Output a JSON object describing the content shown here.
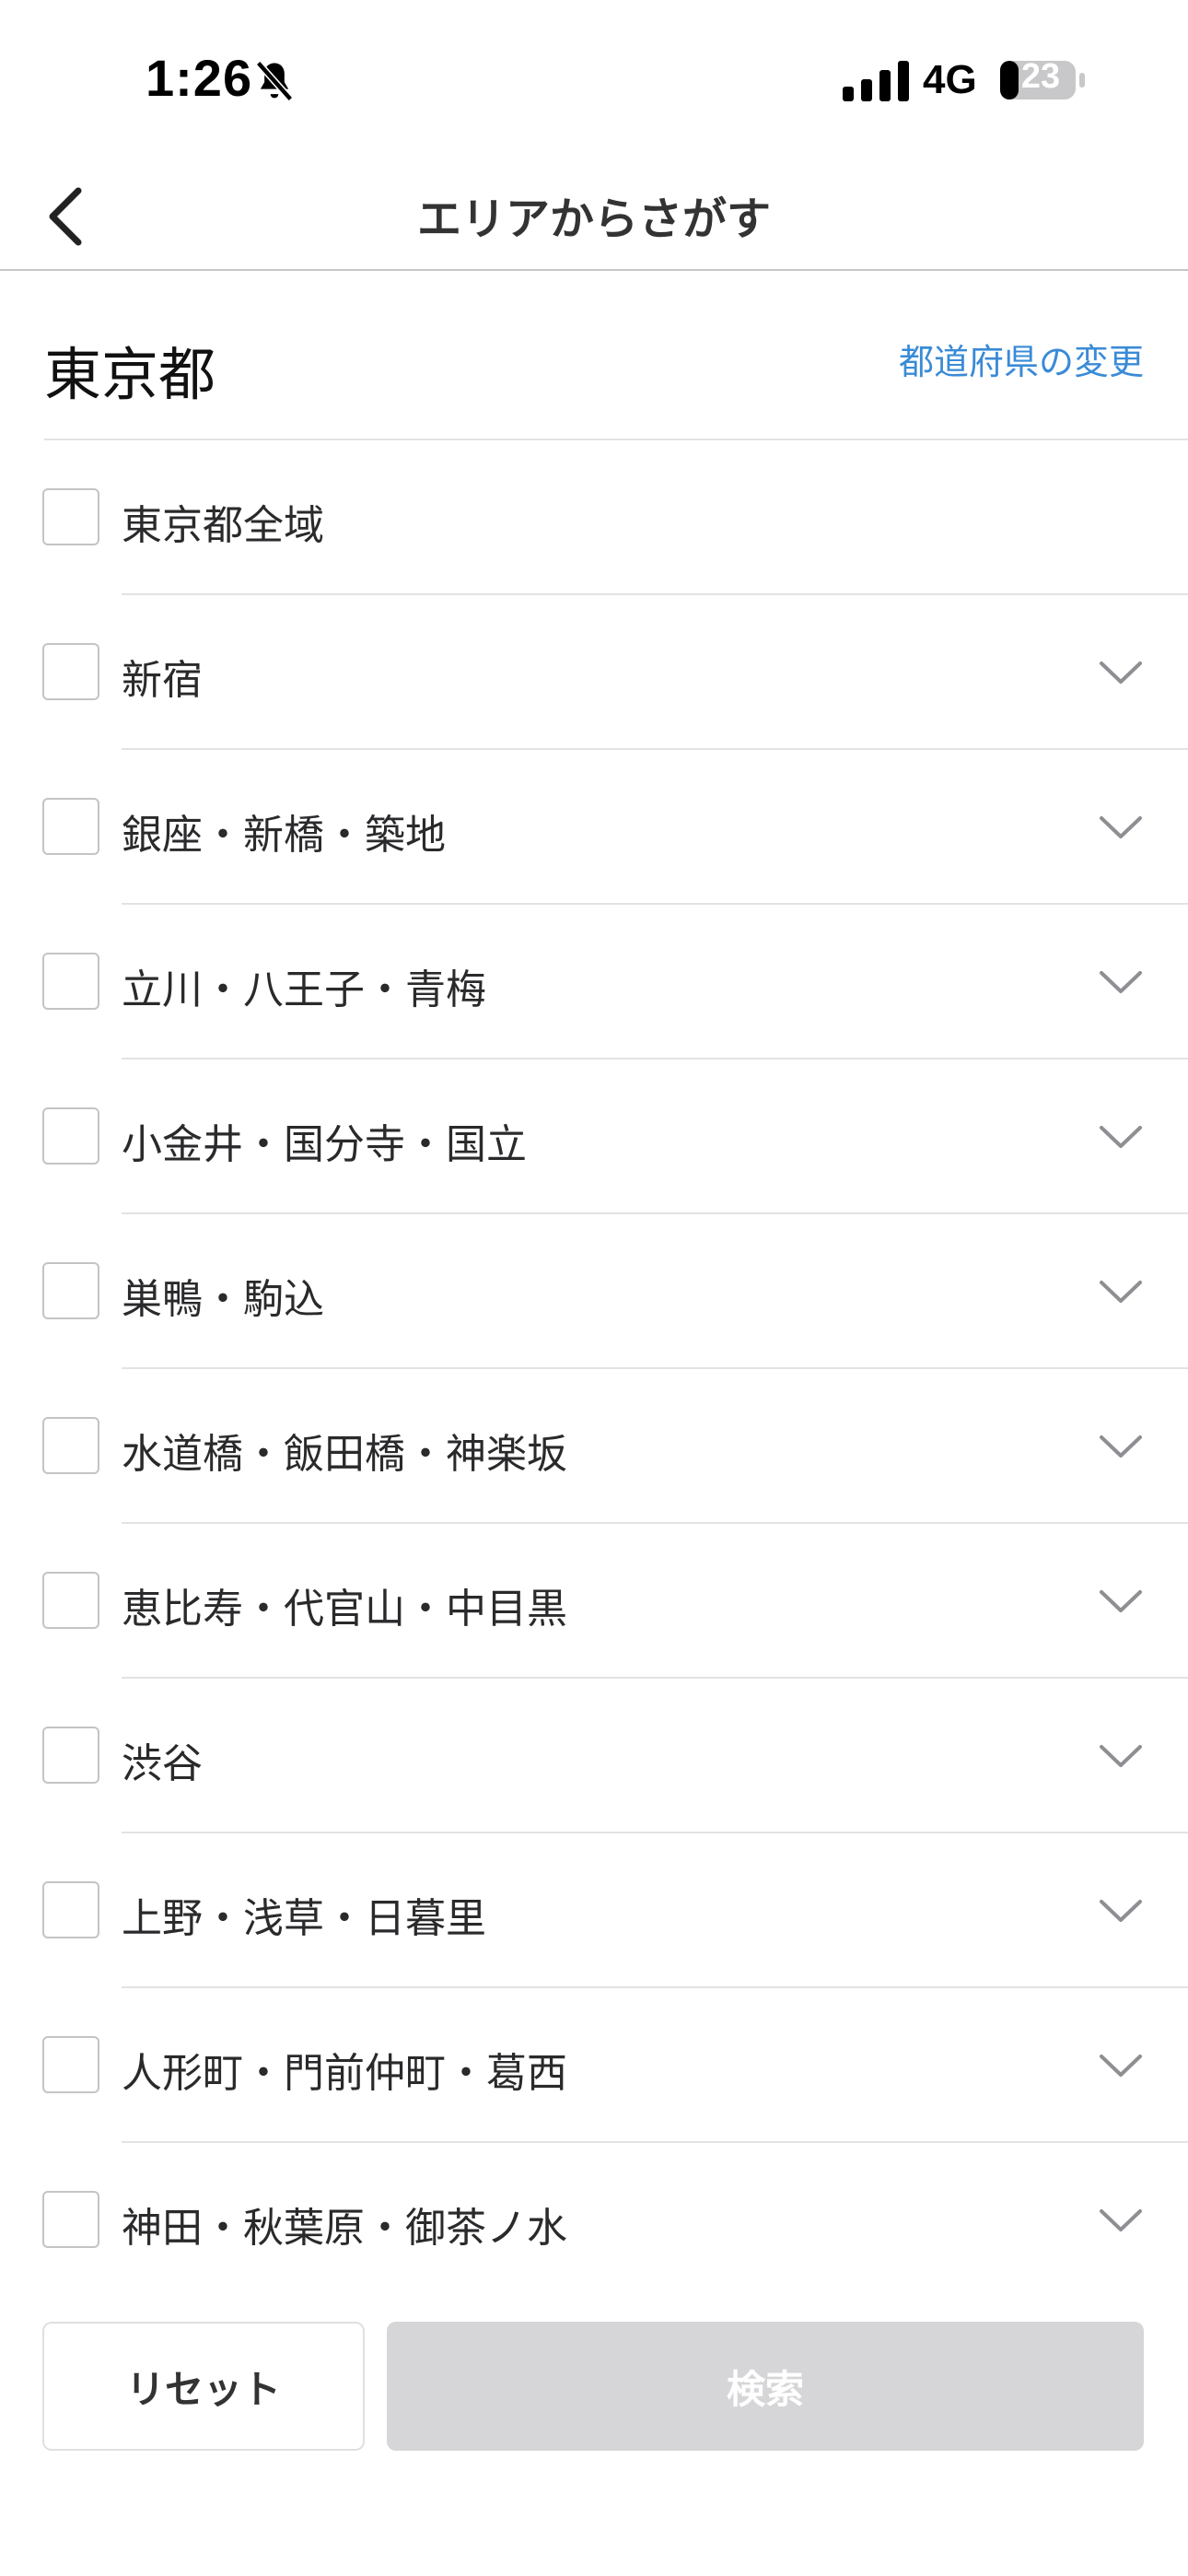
{
  "status_bar": {
    "time": "1:26",
    "network": "4G",
    "battery": "23"
  },
  "nav": {
    "title": "エリアからさがす"
  },
  "prefecture": {
    "name": "東京都",
    "change_label": "都道府県の変更"
  },
  "areas": [
    {
      "label": "東京都全域",
      "expandable": false
    },
    {
      "label": "新宿",
      "expandable": true
    },
    {
      "label": "銀座・新橋・築地",
      "expandable": true
    },
    {
      "label": "立川・八王子・青梅",
      "expandable": true
    },
    {
      "label": "小金井・国分寺・国立",
      "expandable": true
    },
    {
      "label": "巣鴨・駒込",
      "expandable": true
    },
    {
      "label": "水道橋・飯田橋・神楽坂",
      "expandable": true
    },
    {
      "label": "恵比寿・代官山・中目黒",
      "expandable": true
    },
    {
      "label": "渋谷",
      "expandable": true
    },
    {
      "label": "上野・浅草・日暮里",
      "expandable": true
    },
    {
      "label": "人形町・門前仲町・葛西",
      "expandable": true
    },
    {
      "label": "神田・秋葉原・御茶ノ水",
      "expandable": true
    }
  ],
  "actions": {
    "reset_label": "リセット",
    "search_label": "検索"
  },
  "colors": {
    "link": "#3a8bd6",
    "disabled_button": "#d6d6d8"
  }
}
